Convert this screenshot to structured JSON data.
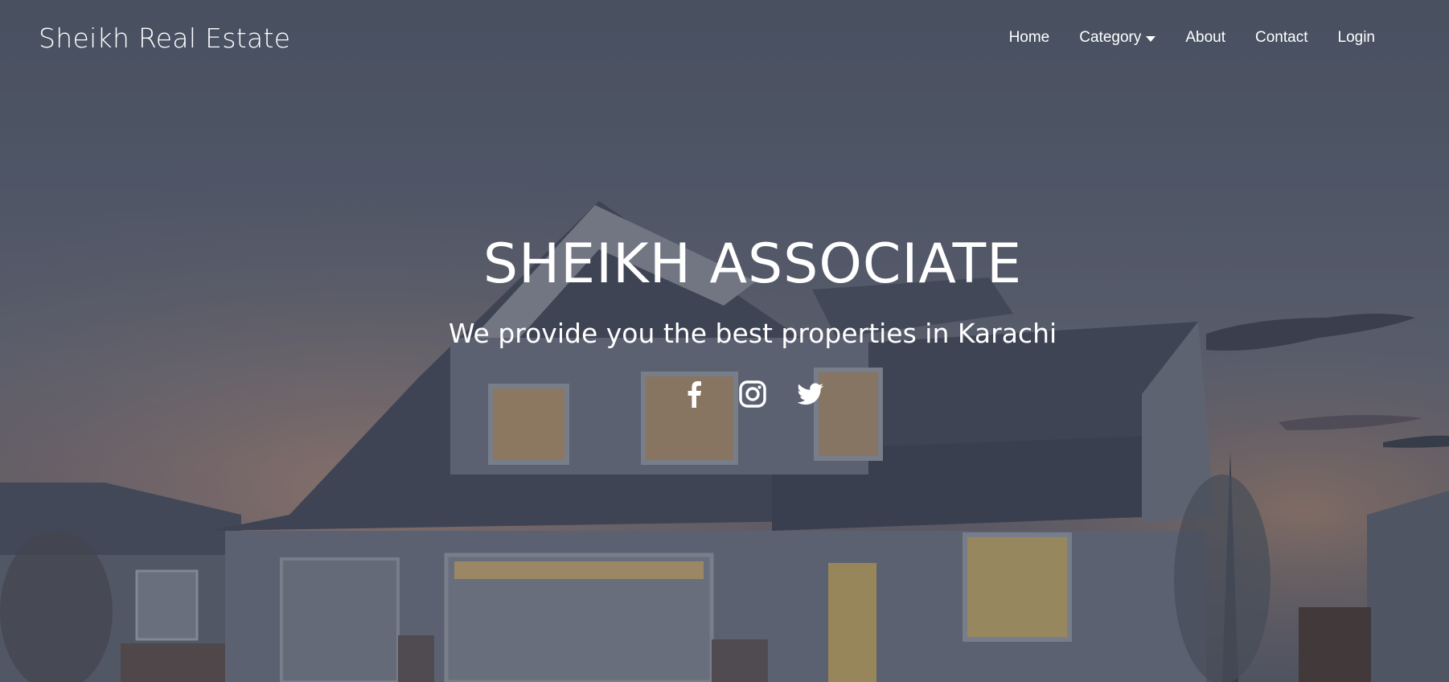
{
  "brand": {
    "name": "Sheikh Real Estate"
  },
  "nav": {
    "home": "Home",
    "category": "Category",
    "about": "About",
    "contact": "Contact",
    "login": "Login"
  },
  "hero": {
    "title": "SHEIKH ASSOCIATE",
    "subtitle": "We provide you the best properties in Karachi"
  },
  "social": {
    "facebook": "facebook-icon",
    "instagram": "instagram-icon",
    "twitter": "twitter-icon"
  },
  "colors": {
    "text": "#ffffff",
    "sky": "#555d6e",
    "window_glow": "#c9a86a"
  }
}
